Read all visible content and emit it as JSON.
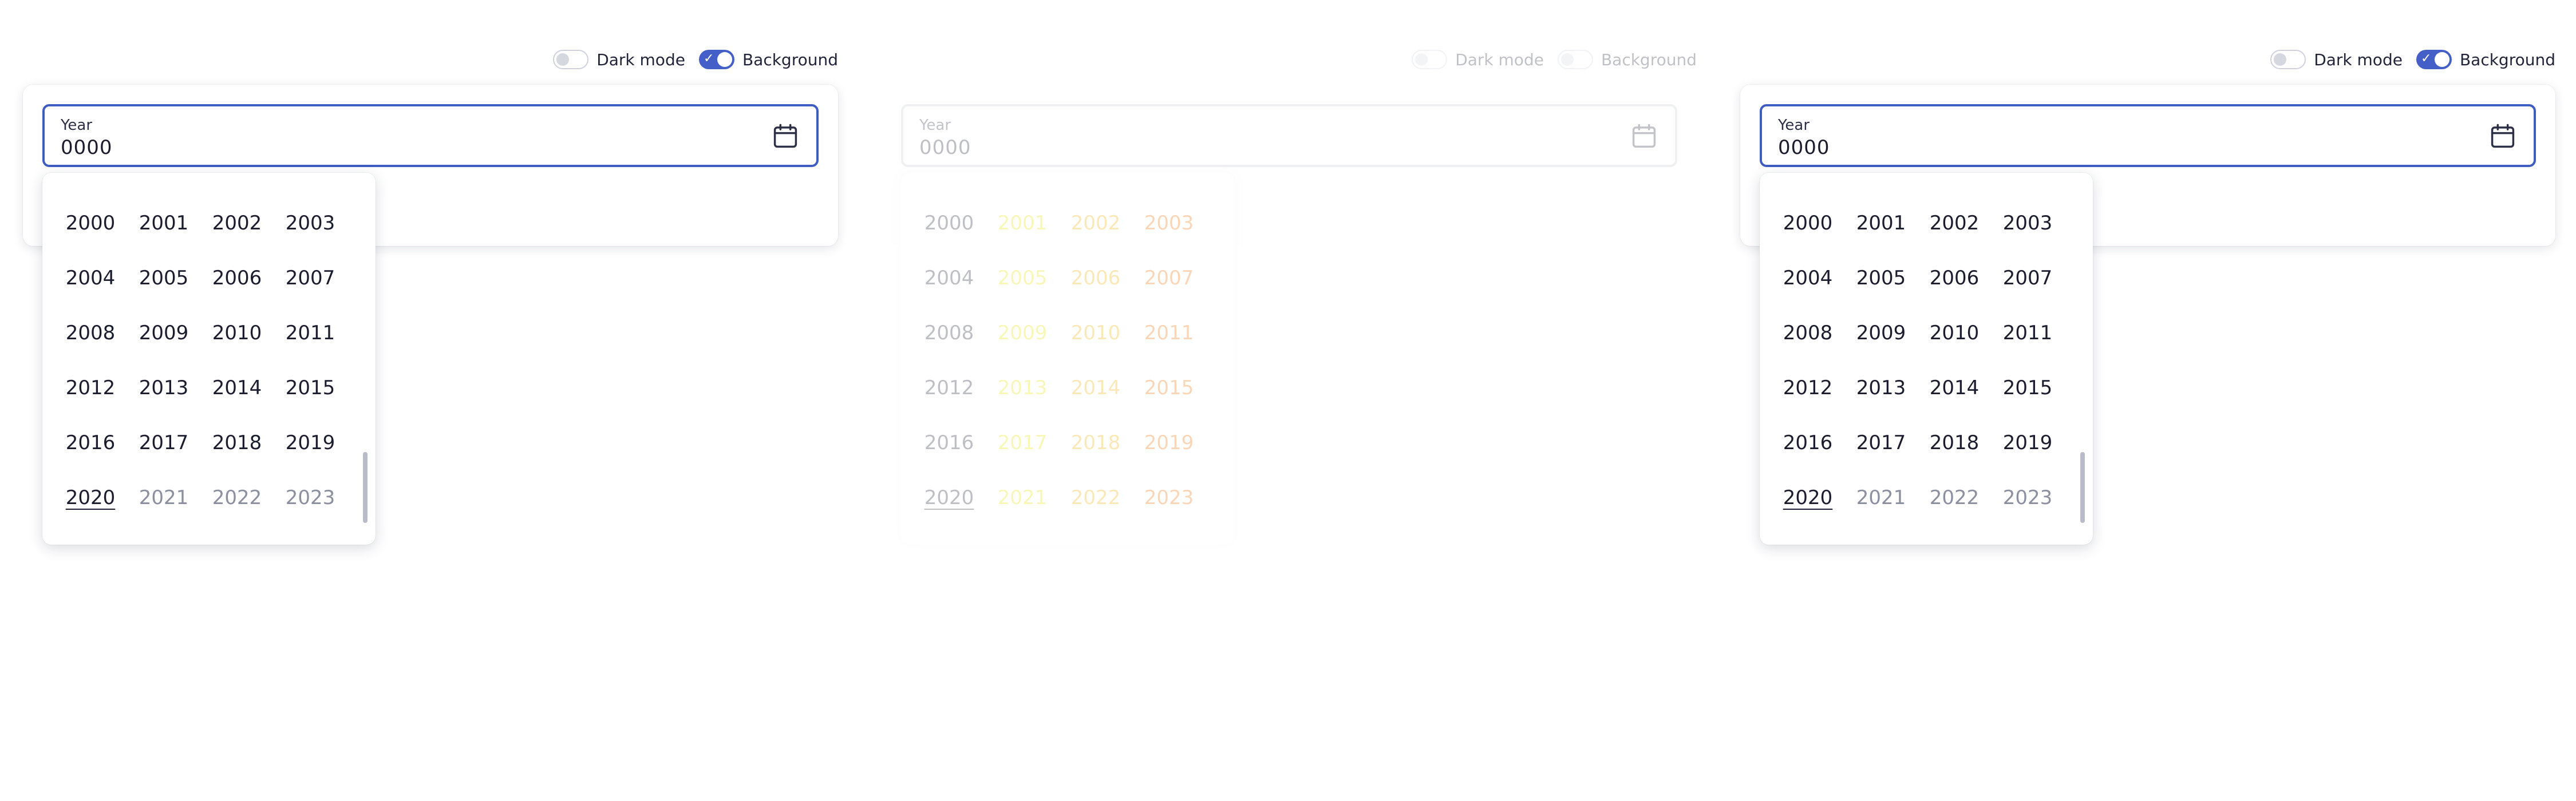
{
  "panels": [
    {
      "toggles": {
        "dark_mode_label": "Dark mode",
        "dark_mode_on": false,
        "background_label": "Background",
        "background_on": true
      },
      "field": {
        "label": "Year",
        "value": "0000"
      }
    },
    {
      "toggles": {
        "dark_mode_label": "Dark mode",
        "dark_mode_on": false,
        "background_label": "Background",
        "background_on": true
      },
      "field": {
        "label": "Year",
        "value": "0000"
      }
    },
    {
      "toggles": {
        "dark_mode_label": "Dark mode",
        "dark_mode_on": false,
        "background_label": "Background",
        "background_on": true
      },
      "field": {
        "label": "Year",
        "value": "0000"
      }
    }
  ],
  "years": [
    "2000",
    "2001",
    "2002",
    "2003",
    "2004",
    "2005",
    "2006",
    "2007",
    "2008",
    "2009",
    "2010",
    "2011",
    "2012",
    "2013",
    "2014",
    "2015",
    "2016",
    "2017",
    "2018",
    "2019",
    "2020",
    "2021",
    "2022",
    "2023"
  ],
  "current_year": "2020",
  "future_years": [
    "2021",
    "2022",
    "2023"
  ],
  "icons": {
    "calendar": "calendar-icon",
    "check": "check-icon"
  },
  "colors": {
    "accent": "#3f5cc3",
    "text": "#1b1d2e",
    "muted": "#8b8fa0",
    "glitch_yellow": "#e8e600",
    "glitch_orange": "#f07000"
  }
}
